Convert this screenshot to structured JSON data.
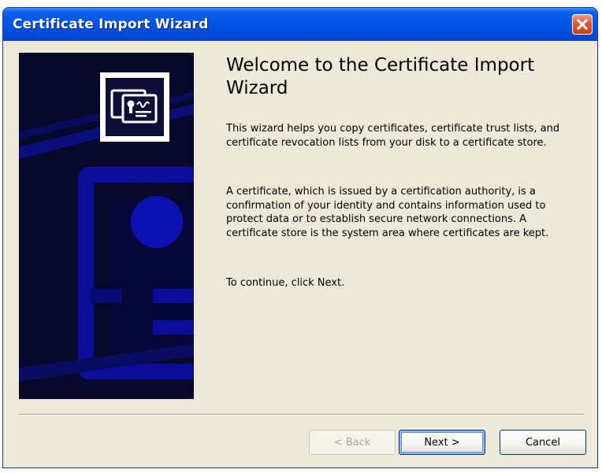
{
  "window": {
    "title": "Certificate Import Wizard"
  },
  "titlebar": {
    "close_icon": "close-x-icon"
  },
  "banner": {
    "icon": "certificate-icon",
    "colors": {
      "background": "#07092a",
      "accent": "#0a0ea8"
    }
  },
  "content": {
    "heading": "Welcome to the Certificate Import Wizard",
    "paragraphs": [
      "This wizard helps you copy certificates, certificate trust lists, and certificate revocation lists from your disk to a certificate store.",
      "A certificate, which is issued by a certification authority, is a confirmation of your identity and contains information used to protect data or to establish secure network connections. A certificate store is the system area where certificates are kept.",
      "To continue, click Next."
    ]
  },
  "buttons": {
    "back_prefix": "< ",
    "back_label": "Back",
    "next_label": "Next",
    "next_suffix": " >",
    "cancel_label": "Cancel"
  }
}
